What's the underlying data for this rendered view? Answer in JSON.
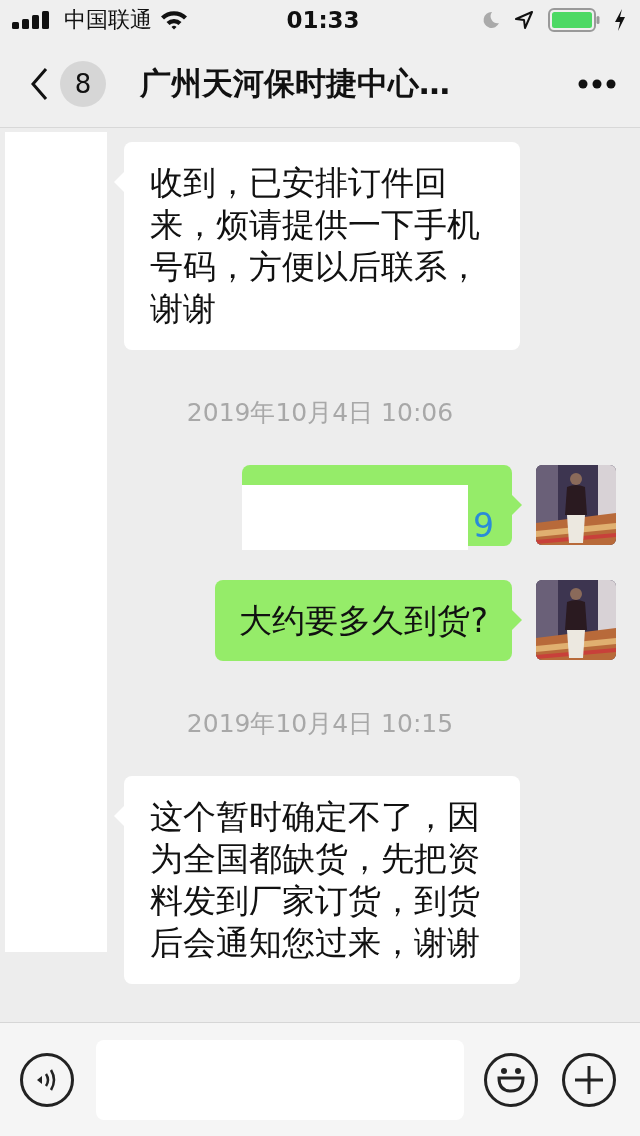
{
  "status_bar": {
    "carrier": "中国联通",
    "time": "01:33"
  },
  "nav_bar": {
    "unread_count": "8",
    "title": "广州天河保时捷中心…"
  },
  "messages": [
    {
      "kind": "incoming",
      "text": "收到，已安排订件回来，烦请提供一下手机号码，方便以后联系，谢谢"
    },
    {
      "kind": "time",
      "text": "2019年10月4日 10:06"
    },
    {
      "kind": "outgoing",
      "text": "9",
      "link": true,
      "redacted": true
    },
    {
      "kind": "outgoing",
      "text": "大约要多久到货?",
      "link": false,
      "redacted": false
    },
    {
      "kind": "time",
      "text": "2019年10月4日 10:15"
    },
    {
      "kind": "incoming",
      "text": "这个暂时确定不了，因为全国都缺货，先把资料发到厂家订货，到货后会通知您过来，谢谢"
    }
  ]
}
